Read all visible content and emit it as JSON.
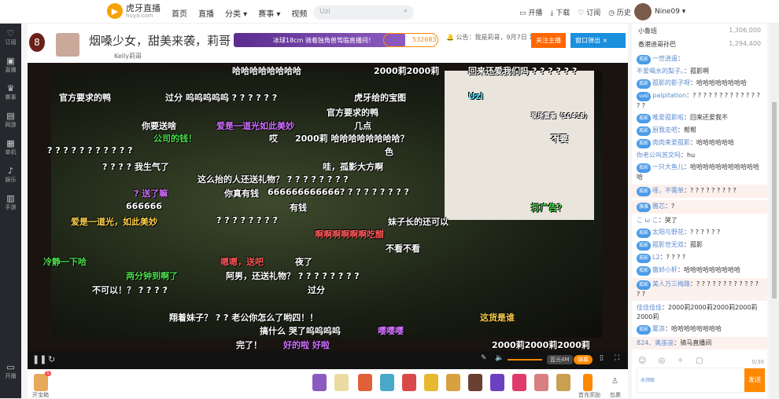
{
  "header": {
    "logo_title": "虎牙直播",
    "logo_sub": "huya.com",
    "nav": [
      "首页",
      "直播",
      "分类 ▾",
      "赛事 ▾",
      "视频"
    ],
    "search_placeholder": "Uzi",
    "tools": [
      "开播",
      "下载",
      "订阅",
      "历史"
    ],
    "username": "Nine09 ▾"
  },
  "leftbar": [
    "订阅",
    "直播",
    "赛事",
    "网游",
    "单机",
    "娱乐",
    "手游"
  ],
  "leftbar_bottom": "开播",
  "room": {
    "level": "8",
    "title": "烟嗓少女，甜美来袭，莉哥",
    "host": "Kelly莉哥",
    "promo": "冰球18cm  骑着独角兽驾临直播间！",
    "hot": "532683",
    "notice": "公告：我是莉哥，9月7日 19:1",
    "follow": "关注主播",
    "popout": "窗口弹出"
  },
  "danmaku": [
    "哈哈哈哈哈哈哈哈",
    "2000莉2000莉",
    "回来还爱我们吗 ? ? ? ? ? ?",
    "官方要求的鸭",
    "过分 呜呜呜呜呜 ? ? ? ? ? ?",
    "虎牙给的宝图",
    "官方要求的鸭",
    "你要送啥",
    "爱是一道光如此美妙",
    "几点",
    "公司的钱！",
    "哎",
    "2000莉 哈哈哈哈哈哈哈哈？",
    "? ? ? ? ? ? ? ? ? ? ?",
    "色",
    "哇，孤影大方啊",
    "? ? ? ? 我生气了",
    "这么抬的人还送礼物？ ? ? ? ? ? ? ? ?",
    "你真有钱",
    "666666666666? ? ? ? ? ? ? ? ?",
    "? 送了嘛",
    "有钱",
    "666666",
    "? ? ? ? ? ? ? ?",
    "爱是一道光，如此美妙",
    "啊啊啊啊啊啊吃醋",
    "妹子长的还可以",
    "不看不看",
    "冷静一下哈",
    "嗯嗯，送吧",
    "夜了",
    "两分钟到啊了",
    "阿男，还送礼物？ ? ? ? ? ? ? ? ?",
    "不可以！？ ? ? ? ?",
    "过分",
    "翔着妹子？ ? ? 老公你怎么了哟四！！",
    "搞什么 哭了呜呜呜呜",
    "嘤嘤嘤",
    "完了！",
    "好的啦 好啦",
    "2000莉2000莉2000莉",
    "打广告？",
    "这货是谁",
    "不要",
    "Uzi",
    "现场重看（10418）"
  ],
  "player": {
    "quality": "蓝光4M",
    "danmaku_toggle": "弹幕"
  },
  "giftbar": {
    "treasure": "开宝箱",
    "treasure_count": "5",
    "first_charge": "首充奖励",
    "bag": "包裹"
  },
  "chat": {
    "rank": [
      {
        "name": "小鲁班",
        "value": "1,306,000"
      },
      {
        "name": "香港迪哥孙巴",
        "value": "1,294,400"
      }
    ],
    "messages": [
      {
        "tag": "孤影",
        "name": "一世逍遥",
        "text": ""
      },
      {
        "tag": "",
        "name": "不爱喝水的梨子。",
        "text": "孤影啊"
      },
      {
        "tag": "孤影",
        "name": "孤影的影子呀",
        "text": "哈哈哈哈哈哈哈哈"
      },
      {
        "tag": "vvkl",
        "name": "palpitation",
        "text": "? ? ? ? ? ? ? ? ? ? ? ? ? ? ?"
      },
      {
        "tag": "孤影",
        "name": "唯爱孤影啦",
        "text": "回来还爱我不"
      },
      {
        "tag": "孤影",
        "name": "厨我走吧",
        "text": "帮帮"
      },
      {
        "tag": "孤影",
        "name": "肉肉来爱孤影",
        "text": "哈哈哈哈哈哈"
      },
      {
        "tag": "",
        "name": "你老公叫苏文吗",
        "text": "hu"
      },
      {
        "tag": "孤影",
        "name": "一只大鱼儿",
        "text": "哈哈哈哈哈哈哈哈哈哈哈哈"
      },
      {
        "tag": "孤影",
        "name": "哑，不需单",
        "text": "? ? ? ? ? ? ? ? ?",
        "hl": true
      },
      {
        "tag": "雅雅",
        "name": "雅芯",
        "text": "?",
        "hl": true
      },
      {
        "tag": "",
        "name": "こ ω こ",
        "text": "哭了"
      },
      {
        "tag": "孤影",
        "name": "太阳与野花",
        "text": "? ? ? ? ? ?"
      },
      {
        "tag": "孤影",
        "name": "孤影世无双",
        "text": "孤影"
      },
      {
        "tag": "孤影",
        "name": "L2",
        "text": "? ? ? ?"
      },
      {
        "tag": "孤影",
        "name": "傲娇小轩",
        "text": "哈哈哈哈哈哈哈哈哈"
      },
      {
        "tag": "孤影",
        "name": "美人万三梅路",
        "text": "? ? ? ? ? ? ? ? ? ? ? ? ? ?",
        "hl": true
      },
      {
        "tag": "",
        "name": "佳佳佳佳",
        "text": "2000莉2000莉2000莉2000莉2000莉"
      },
      {
        "tag": "孤影",
        "name": "夏凉",
        "text": "哈哈哈哈哈哈哈哈"
      },
      {
        "tag": "",
        "name": "824、奥巫巫",
        "text": "骑马直播间",
        "hl": true
      }
    ],
    "count": "0/30",
    "send": "发送",
    "badge": "未领取"
  }
}
